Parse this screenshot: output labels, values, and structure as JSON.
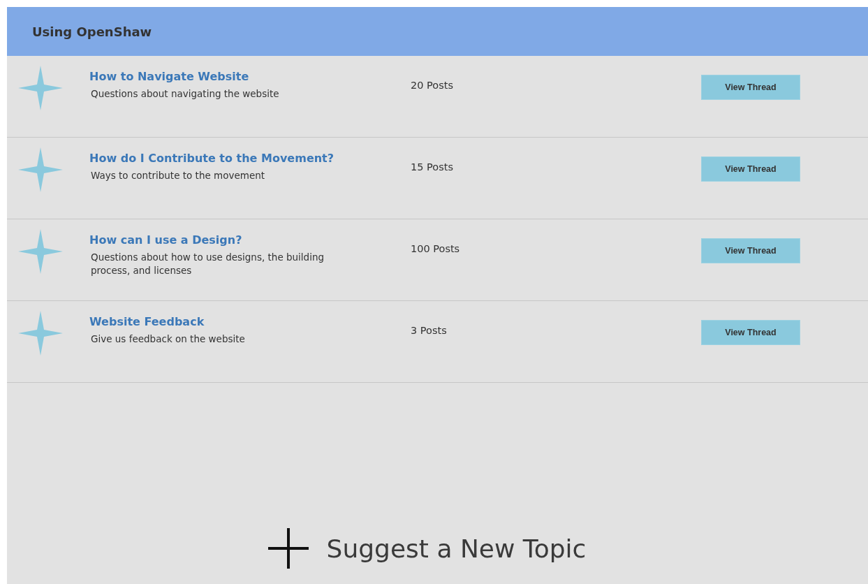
{
  "header": {
    "title": "Using OpenShaw"
  },
  "topics": [
    {
      "title": "How to Navigate Website",
      "description": "Questions about navigating the website",
      "posts": "20 Posts",
      "button": "View Thread"
    },
    {
      "title": "How do I Contribute to the Movement?",
      "description": "Ways to contribute to the movement",
      "posts": "15 Posts",
      "button": "View Thread"
    },
    {
      "title": "How can I use a Design?",
      "description": "Questions about how to use designs, the building process, and licenses",
      "posts": "100 Posts",
      "button": "View Thread"
    },
    {
      "title": "Website Feedback",
      "description": "Give us feedback on the website",
      "posts": "3 Posts",
      "button": "View Thread"
    }
  ],
  "suggest": {
    "label": "Suggest a New Topic"
  }
}
